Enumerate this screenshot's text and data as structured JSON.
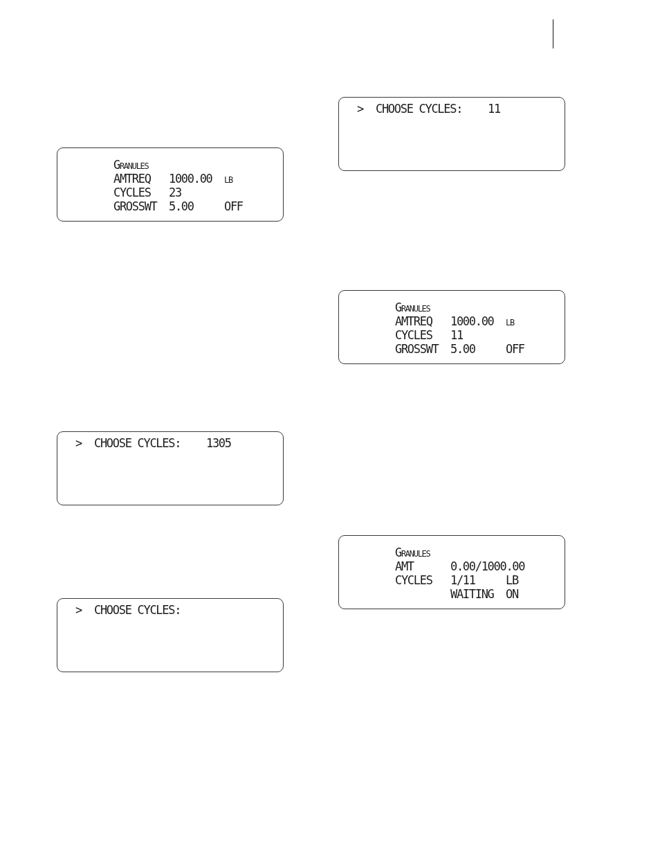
{
  "left_column": {
    "displays": [
      {
        "kind": "status",
        "title": "Granules",
        "rows": [
          {
            "label": "AMTREQ",
            "value": "1000.00",
            "unit": "lb"
          },
          {
            "label": "CYCLES",
            "value": "23"
          },
          {
            "label": "GROSSWT",
            "value": "5.00",
            "status": "OFF"
          }
        ]
      },
      {
        "kind": "prompt",
        "cursor": ">",
        "label": "CHOOSE CYCLES:",
        "value": "1305"
      },
      {
        "kind": "prompt",
        "cursor": ">",
        "label": "CHOOSE CYCLES:"
      }
    ]
  },
  "right_column": {
    "displays": [
      {
        "kind": "prompt",
        "cursor": ">",
        "label": "CHOOSE CYCLES:",
        "value": "11"
      },
      {
        "kind": "status",
        "title": "Granules",
        "rows": [
          {
            "label": "AMTREQ",
            "value": "1000.00",
            "unit": "lb"
          },
          {
            "label": "CYCLES",
            "value": "11"
          },
          {
            "label": "GROSSWT",
            "value": "5.00",
            "status": "OFF"
          }
        ]
      },
      {
        "kind": "status",
        "title": "Granules",
        "rows": [
          {
            "label": "AMT",
            "value": "0.00/1000.00"
          },
          {
            "label": "CYCLES",
            "value": "1/11",
            "unit": "LB"
          },
          {
            "value": "WAITING",
            "status": "ON"
          }
        ]
      }
    ]
  }
}
